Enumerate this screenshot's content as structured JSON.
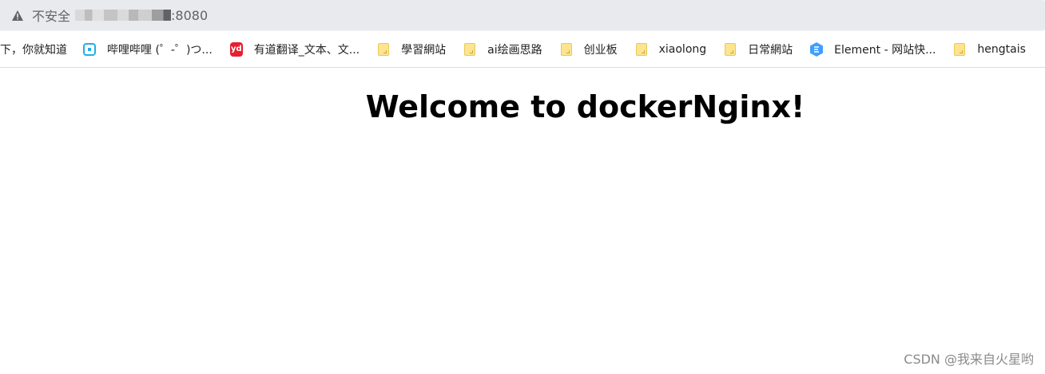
{
  "address_bar": {
    "security_label": "不安全",
    "url_visible": ":8080",
    "warning_icon": "warning-triangle-icon"
  },
  "bookmarks": [
    {
      "label": "下，你就知道",
      "icon": "none"
    },
    {
      "label": "哔哩哔哩 (゜-゜)つ...",
      "icon": "bilibili-icon"
    },
    {
      "label": "有道翻译_文本、文...",
      "icon": "youdao-icon"
    },
    {
      "label": "學習網站",
      "icon": "folder-icon"
    },
    {
      "label": "ai绘画思路",
      "icon": "folder-icon"
    },
    {
      "label": "创业板",
      "icon": "folder-icon"
    },
    {
      "label": "xiaolong",
      "icon": "folder-icon"
    },
    {
      "label": "日常網站",
      "icon": "folder-icon"
    },
    {
      "label": "Element - 网站快...",
      "icon": "element-icon"
    },
    {
      "label": "hengtais",
      "icon": "folder-icon"
    }
  ],
  "page": {
    "heading": "Welcome to dockerNginx!"
  },
  "watermark": "CSDN @我来自火星哟",
  "colors": {
    "folder": "#fce490",
    "bilibili": "#23ade5",
    "youdao": "#e5202f",
    "element": "#409eff"
  }
}
